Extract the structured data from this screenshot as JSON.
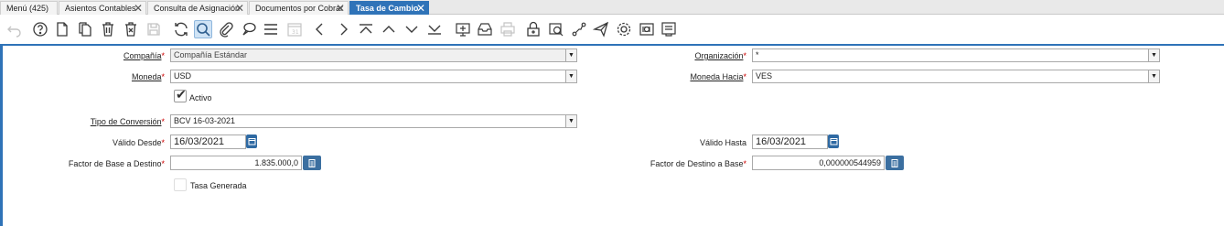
{
  "tabs": [
    {
      "label": "Menú (425)",
      "closable": false,
      "active": false
    },
    {
      "label": "Asientos Contables",
      "closable": true,
      "active": false
    },
    {
      "label": "Consulta de Asignación",
      "closable": true,
      "active": false
    },
    {
      "label": "Documentos por Cobrar",
      "closable": true,
      "active": false
    },
    {
      "label": "Tasa de Cambio",
      "closable": true,
      "active": true
    }
  ],
  "toolbar": {
    "icons": [
      "undo-icon",
      "help-icon",
      "new-record-icon",
      "copy-record-icon",
      "delete-icon",
      "delete-selection-icon",
      "save-icon",
      "refresh-icon",
      "find-icon",
      "attachment-icon",
      "chat-icon",
      "grid-toggle-icon",
      "history-icon",
      "previous-icon",
      "next-icon",
      "first-record-icon",
      "parent-record-icon",
      "detail-record-icon",
      "last-record-icon",
      "report-icon",
      "archived-documents-icon",
      "print-icon",
      "lock-icon",
      "zoom-across-icon",
      "workflow-icon",
      "send-icon",
      "process-icon",
      "product-info-icon",
      "customize-icon"
    ]
  },
  "form": {
    "compania": {
      "label": "Compañía",
      "required": "*",
      "value": "Compañía Estándar"
    },
    "organizacion": {
      "label": "Organización",
      "required": "*",
      "value": "*"
    },
    "moneda": {
      "label": "Moneda",
      "required": "*",
      "value": "USD"
    },
    "moneda_hacia": {
      "label": "Moneda Hacia",
      "required": "*",
      "value": "VES"
    },
    "activo": {
      "label": "Activo",
      "checked": true
    },
    "tipo_conversion": {
      "label": "Tipo de Conversión",
      "required": "*",
      "value": "BCV 16-03-2021"
    },
    "valido_desde": {
      "label": "Válido Desde",
      "required": "*",
      "value": "16/03/2021"
    },
    "valido_hasta": {
      "label": "Válido Hasta",
      "value": "16/03/2021"
    },
    "factor_base_destino": {
      "label": "Factor de Base a Destino",
      "required": "*",
      "value": "1.835.000,0"
    },
    "factor_destino_base": {
      "label": "Factor de Destino a Base",
      "required": "*",
      "value": "0,000000544959"
    },
    "tasa_generada": {
      "label": "Tasa Generada",
      "checked": false
    }
  },
  "colors": {
    "accent": "#2f73b8",
    "required": "#cc0000"
  }
}
